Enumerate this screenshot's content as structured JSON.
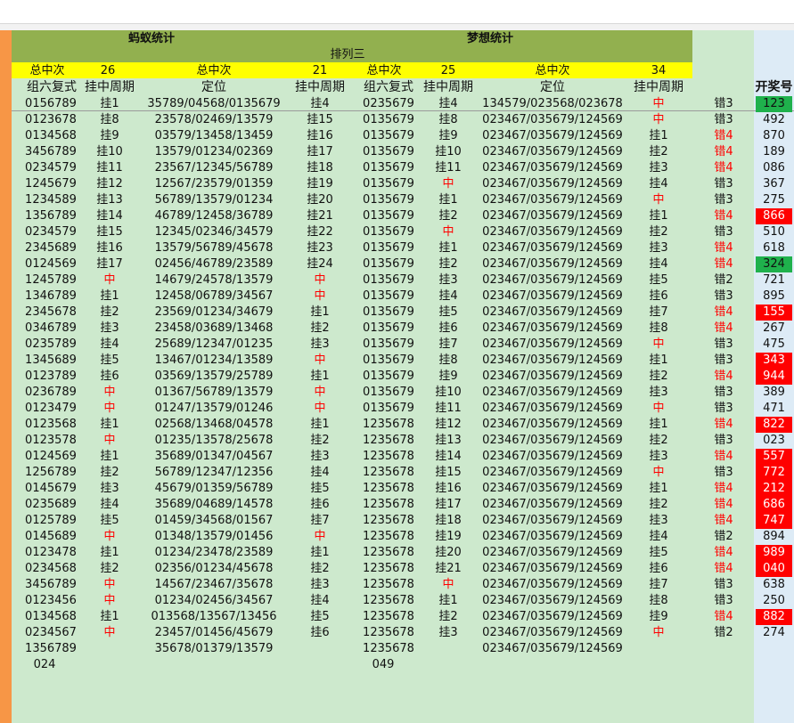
{
  "headers": {
    "ant_title": "蚂蚁统计",
    "dream_title": "梦想统计",
    "sub_title": "排列三",
    "total_label": "总中次",
    "ant_total": "26",
    "ant_total_label2": "总中次",
    "ant_total2": "21",
    "dream_total_label": "总中次",
    "dream_total": "25",
    "dream_total_label2": "总中次",
    "dream_total2": "34",
    "col_group6": "组六复式",
    "col_cycle": "挂中周期",
    "col_position": "定位",
    "col_cycle2": "挂中周期",
    "col_group6_b": "组六复式",
    "col_cycle_b": "挂中周期",
    "col_position_b": "定位",
    "col_cycle2_b": "挂中周期",
    "col_draw": "开奖号"
  },
  "colors": {
    "orange": "#f79646",
    "olive": "#92b04f",
    "yellow": "#ffff00",
    "sheet_green": "#cde9cd",
    "light_blue": "#ddebf6",
    "hit_red": "#ff0000",
    "hit_green": "#1fb14c"
  },
  "rows": [
    [
      "0156789",
      "挂1",
      "35789/04568/0135679",
      "挂4",
      "0235679",
      "挂4",
      "134579/023568/023678",
      "中",
      "错3",
      "123",
      "g"
    ],
    [
      "0123678",
      "挂8",
      "23578/02469/13579",
      "挂15",
      "0135679",
      "挂8",
      "023467/035679/124569",
      "中",
      "错3",
      "492",
      ""
    ],
    [
      "0134568",
      "挂9",
      "03579/13458/13459",
      "挂16",
      "0135679",
      "挂9",
      "023467/035679/124569",
      "挂1",
      "错4",
      "870",
      ""
    ],
    [
      "3456789",
      "挂10",
      "13579/01234/02369",
      "挂17",
      "0135679",
      "挂10",
      "023467/035679/124569",
      "挂2",
      "错4",
      "189",
      ""
    ],
    [
      "0234579",
      "挂11",
      "23567/12345/56789",
      "挂18",
      "0135679",
      "挂11",
      "023467/035679/124569",
      "挂3",
      "错4",
      "086",
      ""
    ],
    [
      "1245679",
      "挂12",
      "12567/23579/01359",
      "挂19",
      "0135679",
      "中",
      "023467/035679/124569",
      "挂4",
      "错3",
      "367",
      ""
    ],
    [
      "1234589",
      "挂13",
      "56789/13579/01234",
      "挂20",
      "0135679",
      "挂1",
      "023467/035679/124569",
      "中",
      "错3",
      "275",
      ""
    ],
    [
      "1356789",
      "挂14",
      "46789/12458/36789",
      "挂21",
      "0135679",
      "挂2",
      "023467/035679/124569",
      "挂1",
      "错4",
      "866",
      "r"
    ],
    [
      "0234579",
      "挂15",
      "12345/02346/34579",
      "挂22",
      "0135679",
      "中",
      "023467/035679/124569",
      "挂2",
      "错3",
      "510",
      ""
    ],
    [
      "2345689",
      "挂16",
      "13579/56789/45678",
      "挂23",
      "0135679",
      "挂1",
      "023467/035679/124569",
      "挂3",
      "错4",
      "618",
      ""
    ],
    [
      "0124569",
      "挂17",
      "02456/46789/23589",
      "挂24",
      "0135679",
      "挂2",
      "023467/035679/124569",
      "挂4",
      "错4",
      "324",
      "g"
    ],
    [
      "1245789",
      "中",
      "14679/24578/13579",
      "中",
      "0135679",
      "挂3",
      "023467/035679/124569",
      "挂5",
      "错2",
      "721",
      ""
    ],
    [
      "1346789",
      "挂1",
      "12458/06789/34567",
      "中",
      "0135679",
      "挂4",
      "023467/035679/124569",
      "挂6",
      "错3",
      "895",
      ""
    ],
    [
      "2345678",
      "挂2",
      "23569/01234/34679",
      "挂1",
      "0135679",
      "挂5",
      "023467/035679/124569",
      "挂7",
      "错4",
      "155",
      "r"
    ],
    [
      "0346789",
      "挂3",
      "23458/03689/13468",
      "挂2",
      "0135679",
      "挂6",
      "023467/035679/124569",
      "挂8",
      "错4",
      "267",
      ""
    ],
    [
      "0235789",
      "挂4",
      "25689/12347/01235",
      "挂3",
      "0135679",
      "挂7",
      "023467/035679/124569",
      "中",
      "错3",
      "475",
      ""
    ],
    [
      "1345689",
      "挂5",
      "13467/01234/13589",
      "中",
      "0135679",
      "挂8",
      "023467/035679/124569",
      "挂1",
      "错3",
      "343",
      "r"
    ],
    [
      "0123789",
      "挂6",
      "03569/13579/25789",
      "挂1",
      "0135679",
      "挂9",
      "023467/035679/124569",
      "挂2",
      "错4",
      "944",
      "r"
    ],
    [
      "0236789",
      "中",
      "01367/56789/13579",
      "中",
      "0135679",
      "挂10",
      "023467/035679/124569",
      "挂3",
      "错3",
      "389",
      ""
    ],
    [
      "0123479",
      "中",
      "01247/13579/01246",
      "中",
      "0135679",
      "挂11",
      "023467/035679/124569",
      "中",
      "错3",
      "471",
      ""
    ],
    [
      "0123568",
      "挂1",
      "02568/13468/04578",
      "挂1",
      "1235678",
      "挂12",
      "023467/035679/124569",
      "挂1",
      "错4",
      "822",
      "r"
    ],
    [
      "0123578",
      "中",
      "01235/13578/25678",
      "挂2",
      "1235678",
      "挂13",
      "023467/035679/124569",
      "挂2",
      "错3",
      "023",
      ""
    ],
    [
      "0124569",
      "挂1",
      "35689/01347/04567",
      "挂3",
      "1235678",
      "挂14",
      "023467/035679/124569",
      "挂3",
      "错4",
      "557",
      "r"
    ],
    [
      "1256789",
      "挂2",
      "56789/12347/12356",
      "挂4",
      "1235678",
      "挂15",
      "023467/035679/124569",
      "中",
      "错3",
      "772",
      "r"
    ],
    [
      "0145679",
      "挂3",
      "45679/01359/56789",
      "挂5",
      "1235678",
      "挂16",
      "023467/035679/124569",
      "挂1",
      "错4",
      "212",
      "r"
    ],
    [
      "0235689",
      "挂4",
      "35689/04689/14578",
      "挂6",
      "1235678",
      "挂17",
      "023467/035679/124569",
      "挂2",
      "错4",
      "686",
      "r"
    ],
    [
      "0125789",
      "挂5",
      "01459/34568/01567",
      "挂7",
      "1235678",
      "挂18",
      "023467/035679/124569",
      "挂3",
      "错4",
      "747",
      "r"
    ],
    [
      "0145689",
      "中",
      "01348/13579/01456",
      "中",
      "1235678",
      "挂19",
      "023467/035679/124569",
      "挂4",
      "错2",
      "894",
      ""
    ],
    [
      "0123478",
      "挂1",
      "01234/23478/23589",
      "挂1",
      "1235678",
      "挂20",
      "023467/035679/124569",
      "挂5",
      "错4",
      "989",
      "r"
    ],
    [
      "0234568",
      "挂2",
      "02356/01234/45678",
      "挂2",
      "1235678",
      "挂21",
      "023467/035679/124569",
      "挂6",
      "错4",
      "040",
      "r"
    ],
    [
      "3456789",
      "中",
      "14567/23467/35678",
      "挂3",
      "1235678",
      "中",
      "023467/035679/124569",
      "挂7",
      "错3",
      "638",
      ""
    ],
    [
      "0123456",
      "中",
      "01234/02456/34567",
      "挂4",
      "1235678",
      "挂1",
      "023467/035679/124569",
      "挂8",
      "错3",
      "250",
      ""
    ],
    [
      "0134568",
      "挂1",
      "013568/13567/13456",
      "挂5",
      "1235678",
      "挂2",
      "023467/035679/124569",
      "挂9",
      "错4",
      "882",
      "r"
    ],
    [
      "0234567",
      "中",
      "23457/01456/45679",
      "挂6",
      "1235678",
      "挂3",
      "023467/035679/124569",
      "中",
      "错2",
      "274",
      ""
    ],
    [
      "1356789",
      "",
      "35678/01379/13579",
      "",
      "1235678",
      "",
      "023467/035679/124569",
      "",
      "",
      "",
      ""
    ]
  ],
  "footer": {
    "ant_next": "024",
    "dream_next": "049"
  }
}
